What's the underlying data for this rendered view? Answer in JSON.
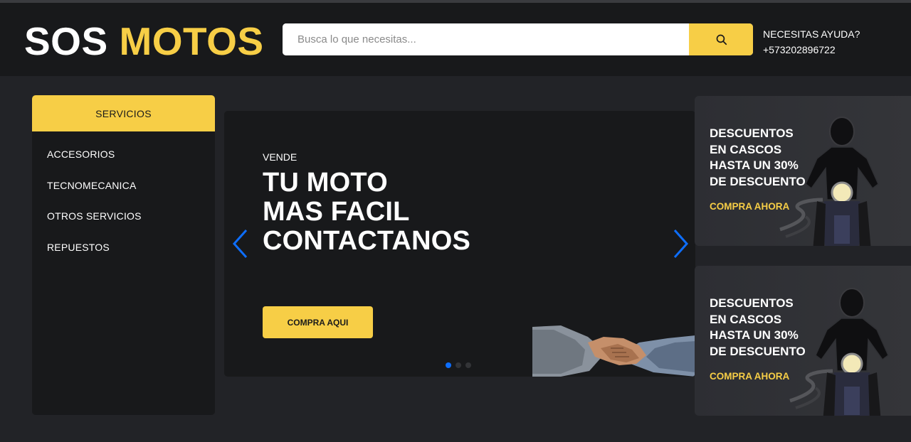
{
  "brand": {
    "logo_part1": "SOS",
    "logo_part2": "MOTOS"
  },
  "search": {
    "placeholder": "Busca lo que necesitas...",
    "value": ""
  },
  "help": {
    "title": "NECESITAS AYUDA?",
    "phone": "+573202896722"
  },
  "sidebar": {
    "header": "SERVICIOS",
    "items": [
      {
        "label": "ACCESORIOS"
      },
      {
        "label": "TECNOMECANICA"
      },
      {
        "label": "OTROS SERVICIOS"
      },
      {
        "label": "REPUESTOS"
      }
    ]
  },
  "slider": {
    "kicker": "VENDE",
    "title_lines": [
      "TU MOTO",
      "MAS FACIL",
      "CONTACTANOS"
    ],
    "button": "COMPRA AQUI",
    "slide_count": 3,
    "active_slide": 1
  },
  "promos": [
    {
      "lines": [
        "DESCUENTOS",
        "EN CASCOS",
        "HASTA UN 30%",
        "DE DESCUENTO"
      ],
      "cta": "COMPRA AHORA"
    },
    {
      "lines": [
        "DESCUENTOS",
        "EN CASCOS",
        "HASTA UN 30%",
        "DE DESCUENTO"
      ],
      "cta": "COMPRA AHORA"
    }
  ],
  "icons": {
    "search": "search-icon",
    "prev": "chevron-left-icon",
    "next": "chevron-right-icon"
  },
  "colors": {
    "accent": "#f7ce46",
    "header_bg": "#18191b",
    "page_bg": "#222327",
    "dot_active": "#0d6efd"
  }
}
